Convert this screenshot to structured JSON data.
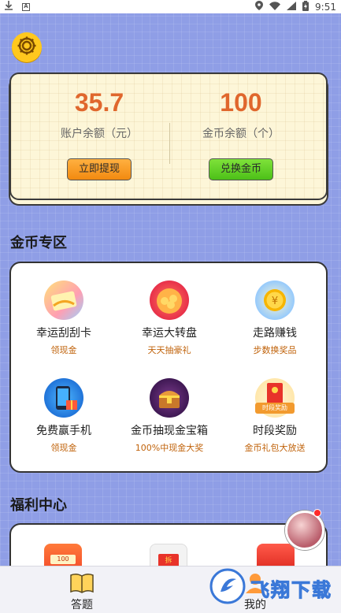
{
  "status_bar": {
    "time": "9:51",
    "a_label": "A"
  },
  "balance": {
    "account_value": "35.7",
    "account_label": "账户余额（元）",
    "withdraw_label": "立即提现",
    "coin_value": "100",
    "coin_label": "金币余额（个）",
    "exchange_label": "兑换金币"
  },
  "gold_zone": {
    "title": "金币专区",
    "items": [
      {
        "title": "幸运刮刮卡",
        "sub": "领现金",
        "icon": "scratch-card-icon"
      },
      {
        "title": "幸运大转盘",
        "sub": "天天抽豪礼",
        "icon": "lucky-wheel-icon"
      },
      {
        "title": "走路赚钱",
        "sub": "步数换奖品",
        "icon": "walk-coin-icon"
      },
      {
        "title": "免费赢手机",
        "sub": "领现金",
        "icon": "phone-gift-icon"
      },
      {
        "title": "金币抽现金宝箱",
        "sub": "100%中现金大奖",
        "icon": "treasure-chest-icon"
      },
      {
        "title": "时段奖励",
        "sub": "金币礼包大放送",
        "icon": "red-envelope-icon",
        "badge": "时段奖励"
      }
    ]
  },
  "welfare": {
    "title": "福利中心",
    "icon_label_1": "100",
    "icon_label_2": "拆"
  },
  "bottom_nav": {
    "answer_label": "答题",
    "mine_label": "我的"
  },
  "watermark": {
    "text": "飞翔下载"
  },
  "colors": {
    "accent_orange": "#e0672d",
    "page_bg": "#8f9ee6",
    "card_bg": "#fdf6d8"
  }
}
